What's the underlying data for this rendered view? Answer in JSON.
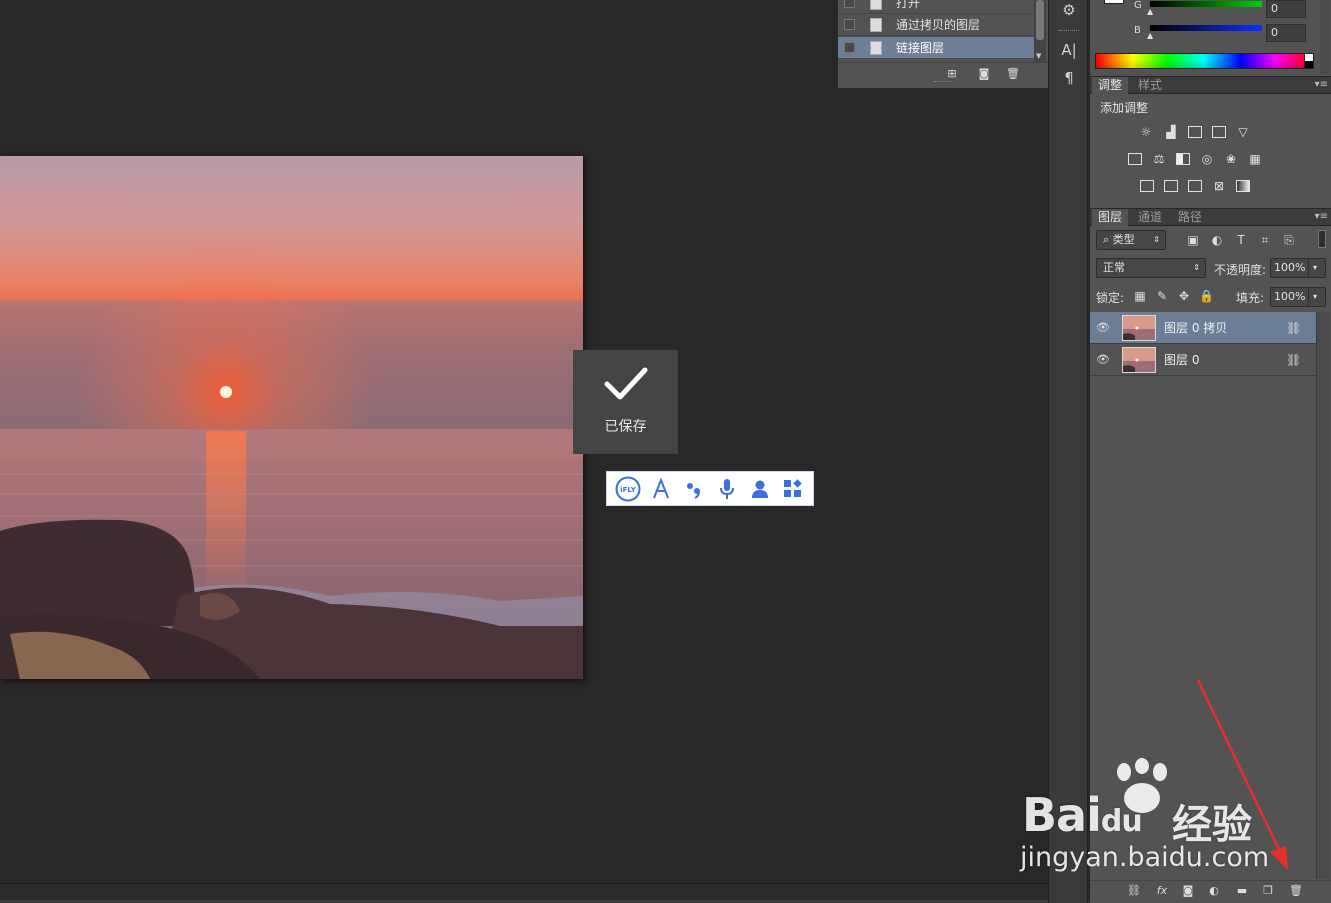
{
  "history": {
    "items": [
      {
        "label": "打开"
      },
      {
        "label": "通过拷贝的图层"
      },
      {
        "label": "链接图层",
        "active": true
      }
    ]
  },
  "toast": {
    "label": "已保存"
  },
  "ifly_toolbar": {
    "buttons": [
      "ifly-logo-icon",
      "text-a-icon",
      "punctuation-icon",
      "microphone-icon",
      "person-icon",
      "apps-icon"
    ],
    "accent_color": "#3b6fde"
  },
  "color_panel": {
    "g_label": "G",
    "b_label": "B",
    "g_value": "0",
    "b_value": "0"
  },
  "adjust_tabs": {
    "active": "调整",
    "other": "样式"
  },
  "adjustments": {
    "header": "添加调整"
  },
  "layer_tabs": [
    "图层",
    "通道",
    "路径"
  ],
  "layers_controls": {
    "filter": "类型",
    "blend_mode": "正常",
    "opacity_label": "不透明度:",
    "opacity_value": "100%",
    "lock_label": "锁定:",
    "fill_label": "填充:",
    "fill_value": "100%"
  },
  "layers": [
    {
      "name": "图层 0 拷贝",
      "selected": true,
      "linked": true
    },
    {
      "name": "图层 0",
      "selected": false,
      "linked": true
    }
  ],
  "watermark": {
    "brand": "Bai",
    "brand_suffix": "du",
    "chinese": "经验",
    "url": "jingyan.baidu.com"
  },
  "colors": {
    "panel_bg": "#535353",
    "selection": "#6c7e95",
    "canvas_bg": "#282828",
    "annotation_arrow": "#e8302a"
  }
}
